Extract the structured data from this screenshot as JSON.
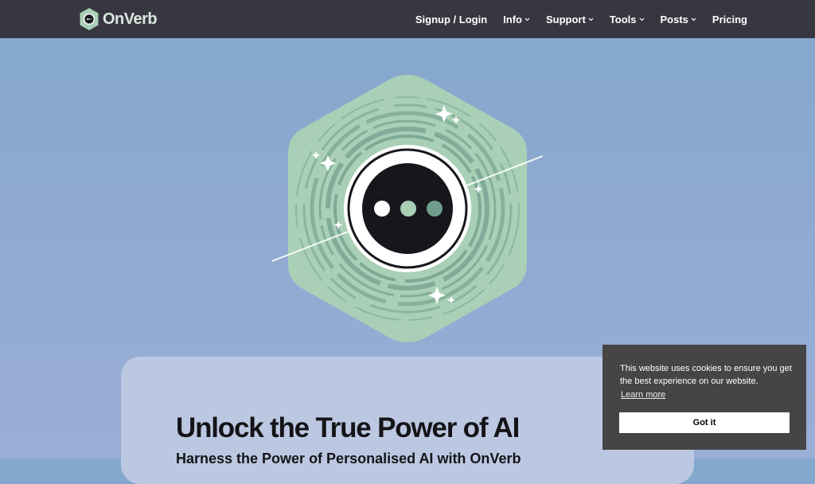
{
  "header": {
    "brand": "OnVerb",
    "nav": [
      {
        "label": "Signup / Login",
        "dropdown": false
      },
      {
        "label": "Info",
        "dropdown": true
      },
      {
        "label": "Support",
        "dropdown": true
      },
      {
        "label": "Tools",
        "dropdown": true
      },
      {
        "label": "Posts",
        "dropdown": true
      },
      {
        "label": "Pricing",
        "dropdown": false
      }
    ]
  },
  "hero": {
    "title": "Unlock the True Power of AI",
    "subtitle": "Harness the Power of Personalised AI with OnVerb"
  },
  "cookie": {
    "message": "This website uses cookies to ensure you get the best experience on our website.",
    "learn_more": "Learn more",
    "accept": "Got it"
  },
  "colors": {
    "header_bg": "#383741",
    "brand_green": "#a9d0b7",
    "accent_green": "#6f9d8b",
    "page_bg": "#8ea9d0",
    "card_bg": "#bcc8e1",
    "cookie_bg": "#454545"
  },
  "icons": [
    "onverb-logo-icon",
    "chevron-down-icon",
    "hexagon-chat-illustration"
  ]
}
